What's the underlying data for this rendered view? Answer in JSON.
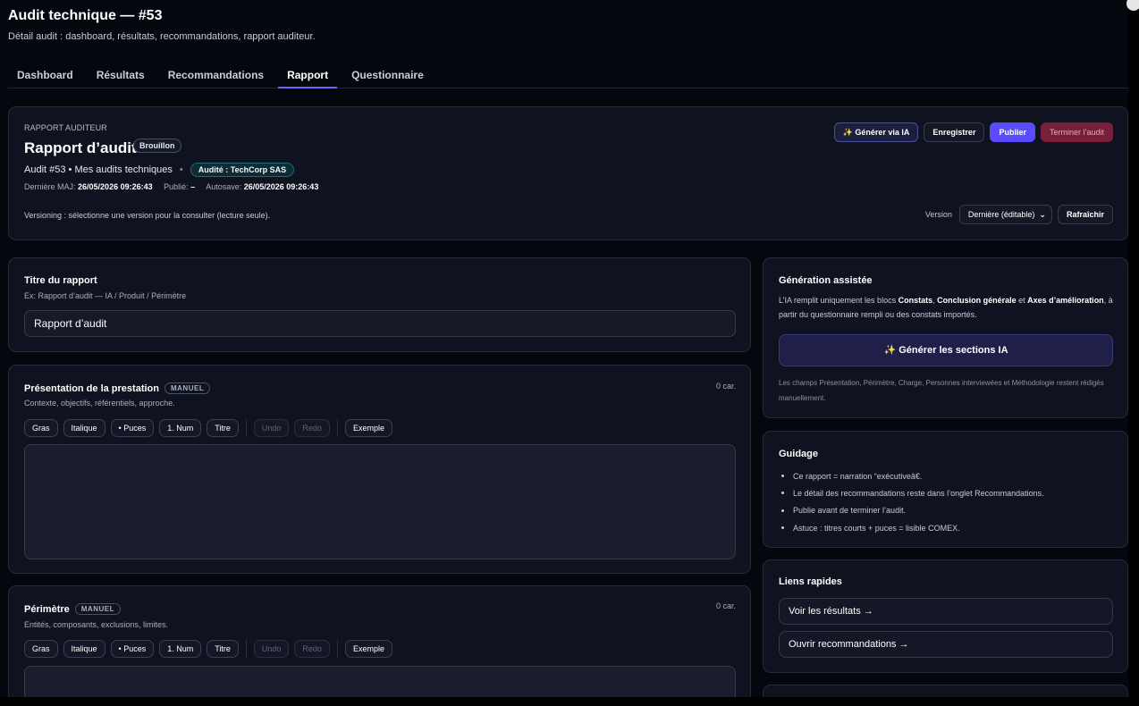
{
  "header": {
    "title": "Audit technique — #53",
    "subtitle": "Détail audit : dashboard, résultats, recommandations, rapport auditeur."
  },
  "tabs": [
    {
      "label": "Dashboard",
      "active": false
    },
    {
      "label": "Résultats",
      "active": false
    },
    {
      "label": "Recommandations",
      "active": false
    },
    {
      "label": "Rapport",
      "active": true
    },
    {
      "label": "Questionnaire",
      "active": false
    }
  ],
  "report_header": {
    "kicker": "RAPPORT AUDITEUR",
    "title": "Rapport d’audit",
    "status_badge": "Brouillon",
    "meta_audit": "Audit #53 • Mes audits techniques",
    "meta_dot": "•",
    "audited_badge": "Audité : TechCorp SAS",
    "last_update_label": "Dernière MAJ:",
    "last_update_value": "26/05/2026 09:26:43",
    "published_label": "Publié:",
    "published_value": "–",
    "autosave_label": "Autosave:",
    "autosave_value": "26/05/2026 09:26:43",
    "versioning_text": "Versioning : sélectionne une version pour la consulter (lecture seule).",
    "buttons": {
      "generate_ai": "✨ Générer via IA",
      "save": "Enregistrer",
      "publish": "Publier",
      "terminate": "Terminer l’audit"
    },
    "version_label": "Version",
    "version_selected": "Dernière (éditable)",
    "refresh": "Rafraîchir"
  },
  "title_section": {
    "label": "Titre du rapport",
    "hint": "Ex: Rapport d’audit — IA / Produit / Périmètre",
    "value": "Rapport d’audit"
  },
  "toolbar": {
    "bold": "Gras",
    "italic": "Italique",
    "bullets": "• Puces",
    "numbered": "1. Num",
    "heading": "Titre",
    "undo": "Undo",
    "redo": "Redo",
    "example": "Exemple"
  },
  "presentation": {
    "label": "Présentation de la prestation",
    "badge": "MANUEL",
    "hint": "Contexte, objectifs, référentiels, approche.",
    "count": "0 car."
  },
  "perimetre": {
    "label": "Périmètre",
    "badge": "MANUEL",
    "hint": "Entités, composants, exclusions, limites.",
    "count": "0 car."
  },
  "assisted": {
    "title": "Génération assistée",
    "text_1": "L’IA remplit uniquement les blocs ",
    "strong_1": "Constats",
    "text_2": ", ",
    "strong_2": "Conclusion générale",
    "text_3": " et ",
    "strong_3": "Axes d’amélioration",
    "text_4": ", à partir du questionnaire rempli ou des constats importés.",
    "button": "✨ Générer les sections IA",
    "note": "Les champs Présentation, Périmètre, Charge, Personnes interviewées et Méthodologie restent rédigés manuellement."
  },
  "guidage": {
    "title": "Guidage",
    "items": [
      "Ce rapport = narration “exécutiveâ€.",
      "Le détail des recommandations reste dans l’onglet Recommandations.",
      "Publie avant de terminer l’audit.",
      "Astuce : titres courts + puces = lisible COMEX."
    ]
  },
  "quick_links": {
    "title": "Liens rapides",
    "results": "Voir les résultats →",
    "recommendations": "Ouvrir recommandations →"
  },
  "colors": {
    "accent": "#5b4dff",
    "danger": "#7a1f3a",
    "background": "#05070f",
    "card": "#0f1320"
  }
}
